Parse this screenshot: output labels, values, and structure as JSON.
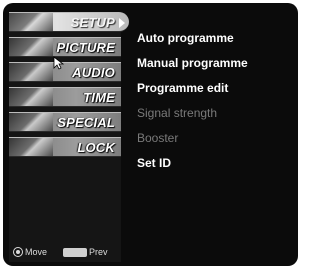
{
  "menu": {
    "items": [
      {
        "label": "SETUP",
        "selected": true
      },
      {
        "label": "PICTURE",
        "selected": false
      },
      {
        "label": "AUDIO",
        "selected": false
      },
      {
        "label": "TIME",
        "selected": false
      },
      {
        "label": "SPECIAL",
        "selected": false
      },
      {
        "label": "LOCK",
        "selected": false
      }
    ]
  },
  "submenu": {
    "items": [
      {
        "label": "Auto programme",
        "enabled": true
      },
      {
        "label": "Manual programme",
        "enabled": true
      },
      {
        "label": "Programme edit",
        "enabled": true
      },
      {
        "label": "Signal strength",
        "enabled": false
      },
      {
        "label": "Booster",
        "enabled": false
      },
      {
        "label": "Set ID",
        "enabled": true
      }
    ]
  },
  "footer": {
    "move_label": "Move",
    "prev_label": "Prev"
  },
  "colors": {
    "background": "#0b0b0b",
    "text_enabled": "#ffffff",
    "text_disabled": "#7a7a7a",
    "selected_tab": "#e2e2e2"
  },
  "icons": {
    "pointer": "cursor-arrow-icon",
    "move": "nav-wheel-icon",
    "prev": "menu-key-icon",
    "submenu_arrow": "arrow-right-icon"
  }
}
